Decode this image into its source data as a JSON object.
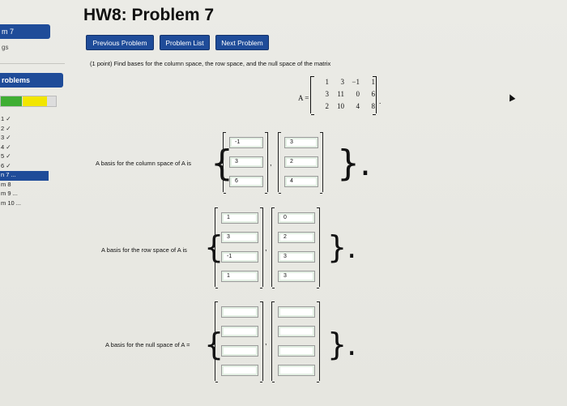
{
  "sidebar": {
    "tab_title": "m 7",
    "tab_sub": "gs",
    "problems_label": "roblems",
    "problems": [
      {
        "label": "1 ✓",
        "current": false
      },
      {
        "label": "2 ✓",
        "current": false
      },
      {
        "label": "3 ✓",
        "current": false
      },
      {
        "label": "4 ✓",
        "current": false
      },
      {
        "label": "5 ✓",
        "current": false
      },
      {
        "label": "6 ✓",
        "current": false
      },
      {
        "label": "n 7 ...",
        "current": true
      },
      {
        "label": "m 8",
        "current": false
      },
      {
        "label": "m 9 ...",
        "current": false
      },
      {
        "label": "m 10 ...",
        "current": false
      }
    ]
  },
  "header": {
    "title": "HW8: Problem 7"
  },
  "nav": {
    "previous": "Previous Problem",
    "list": "Problem List",
    "next": "Next Problem"
  },
  "problem": {
    "intro": "(1 point) Find bases for the column space, the row space, and the null space of the matrix",
    "matrix_label": "A =",
    "matrix": [
      [
        "1",
        "3",
        "−1",
        "1"
      ],
      [
        "3",
        "11",
        "0",
        "6"
      ],
      [
        "2",
        "10",
        "4",
        "8"
      ]
    ],
    "matrix_end": "."
  },
  "column_space": {
    "label": "A basis for the column space of A is",
    "vectors": [
      [
        "-1",
        "3",
        "6"
      ],
      [
        "3",
        "2",
        "4"
      ]
    ]
  },
  "row_space": {
    "label": "A basis for the row space of A is",
    "vectors": [
      [
        "1",
        "3",
        "-1",
        "1"
      ],
      [
        "0",
        "2",
        "3",
        "3"
      ]
    ]
  },
  "null_space": {
    "label": "A basis for the null space of A =",
    "vectors": [
      [
        "",
        "",
        "",
        ""
      ],
      [
        "",
        "",
        "",
        ""
      ]
    ]
  }
}
